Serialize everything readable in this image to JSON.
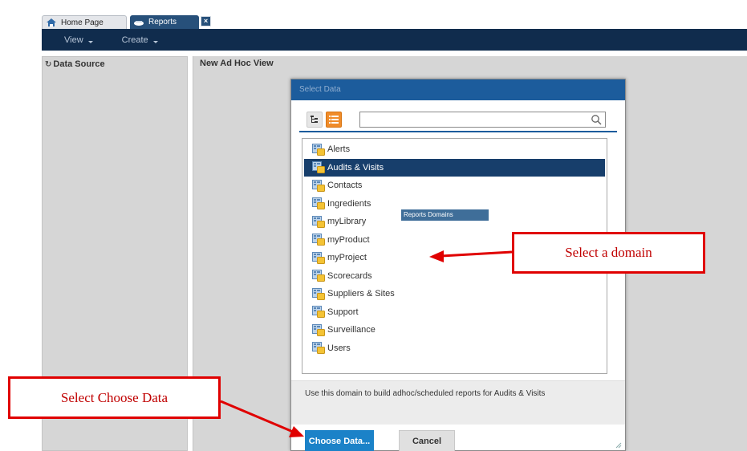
{
  "tabs": [
    {
      "label": "Home Page",
      "active": false
    },
    {
      "label": "Reports",
      "active": true
    }
  ],
  "tab_close_label": "×",
  "menu": [
    {
      "label": "View"
    },
    {
      "label": "Create"
    }
  ],
  "left_panel": {
    "title": "Data Source"
  },
  "main_panel": {
    "title": "New Ad Hoc View"
  },
  "dialog": {
    "title": "Select Data",
    "search": {
      "value": "",
      "placeholder": ""
    },
    "items": [
      {
        "label": "Alerts",
        "selected": false
      },
      {
        "label": "Audits & Visits",
        "selected": true
      },
      {
        "label": "Contacts",
        "selected": false
      },
      {
        "label": "Ingredients",
        "selected": false
      },
      {
        "label": "myLibrary",
        "selected": false
      },
      {
        "label": "myProduct",
        "selected": false
      },
      {
        "label": "myProject",
        "selected": false
      },
      {
        "label": "Scorecards",
        "selected": false
      },
      {
        "label": "Suppliers & Sites",
        "selected": false
      },
      {
        "label": "Support",
        "selected": false
      },
      {
        "label": "Surveillance",
        "selected": false
      },
      {
        "label": "Users",
        "selected": false
      }
    ],
    "tooltip": "Reports Domains",
    "description": "Use this domain to build adhoc/scheduled reports for Audits & Visits",
    "choose_button": "Choose Data...",
    "cancel_button": "Cancel"
  },
  "callouts": {
    "select_domain": "Select a domain",
    "select_choose": "Select Choose Data"
  },
  "colors": {
    "menubar": "#102c4d",
    "dialog_title": "#1c5c9c",
    "selected_item": "#173e6b",
    "primary_button": "#1b82c8",
    "list_view_button": "#f08c2a",
    "callout_red": "#e00000"
  },
  "icons": {
    "home_tab": "home-icon",
    "reports_tab": "reports-icon",
    "tree_view": "tree-view-icon",
    "list_view": "list-view-icon",
    "search": "search-icon",
    "domain": "domain-icon",
    "refresh": "refresh-icon",
    "resize": "resize-grip-icon"
  }
}
